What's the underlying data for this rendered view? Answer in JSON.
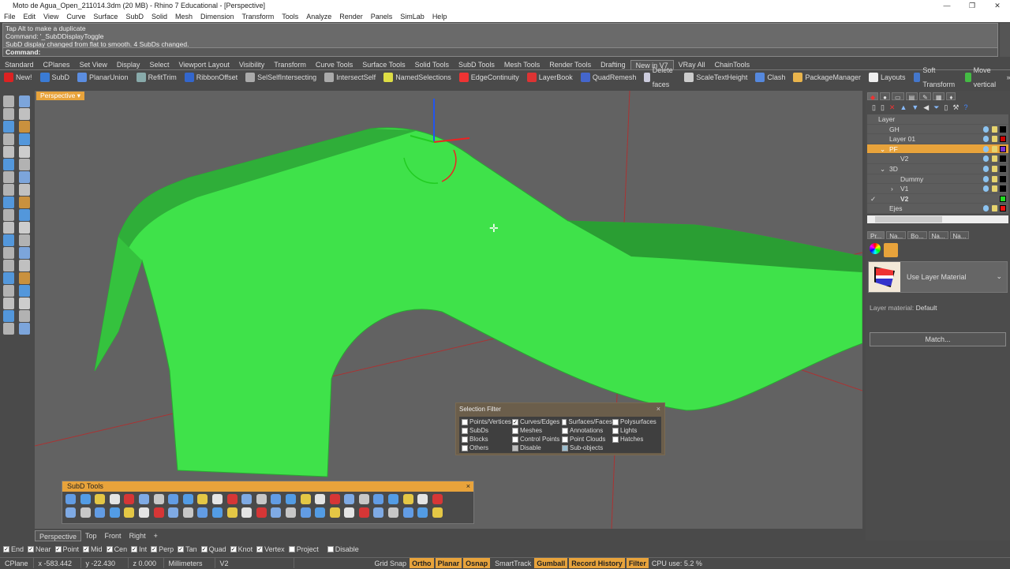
{
  "title": "Moto de Agua_Open_211014.3dm (20 MB) - Rhino 7 Educational - [Perspective]",
  "window_controls": [
    "—",
    "❐",
    "✕"
  ],
  "menu": [
    "File",
    "Edit",
    "View",
    "Curve",
    "Surface",
    "SubD",
    "Solid",
    "Mesh",
    "Dimension",
    "Transform",
    "Tools",
    "Analyze",
    "Render",
    "Panels",
    "SimLab",
    "Help"
  ],
  "command_history": [
    "Tap Alt to make a duplicate",
    "Command: '_SubDDisplayToggle",
    "SubD display changed from flat to smooth. 4 SubDs changed."
  ],
  "command_prompt": "Command:",
  "toolbar_tabs": [
    "Standard",
    "CPlanes",
    "Set View",
    "Display",
    "Select",
    "Viewport Layout",
    "Visibility",
    "Transform",
    "Curve Tools",
    "Surface Tools",
    "Solid Tools",
    "SubD Tools",
    "Mesh Tools",
    "Render Tools",
    "Drafting",
    "New in V7",
    "VRay All",
    "ChainTools"
  ],
  "active_tab": "New in V7",
  "toolbar_buttons": [
    {
      "label": "New!",
      "color": "#d22"
    },
    {
      "label": "SubD",
      "color": "#3a7bd5"
    },
    {
      "label": "PlanarUnion",
      "color": "#5b8de0"
    },
    {
      "label": "RefitTrim",
      "color": "#8aa"
    },
    {
      "label": "RibbonOffset",
      "color": "#36c"
    },
    {
      "label": "SelSelfIntersecting",
      "color": "#aaa"
    },
    {
      "label": "IntersectSelf",
      "color": "#aaa"
    },
    {
      "label": "NamedSelections",
      "color": "#dd4"
    },
    {
      "label": "EdgeContinuity",
      "color": "#e33"
    },
    {
      "label": "LayerBook",
      "color": "#d33"
    },
    {
      "label": "QuadRemesh",
      "color": "#46c"
    },
    {
      "label": "Delete faces",
      "color": "#ccd"
    },
    {
      "label": "ScaleTextHeight",
      "color": "#ccc"
    },
    {
      "label": "Clash",
      "color": "#58d"
    },
    {
      "label": "PackageManager",
      "color": "#e9b44c"
    },
    {
      "label": "Layouts",
      "color": "#eee"
    },
    {
      "label": "Soft Transform",
      "color": "#47c"
    },
    {
      "label": "Move vertical",
      "color": "#4b4"
    }
  ],
  "viewport": {
    "label": "Perspective ▾"
  },
  "layers": {
    "header": "Layer",
    "rows": [
      {
        "name": "GH",
        "indent": 1,
        "color": "#000000"
      },
      {
        "name": "Layer 01",
        "indent": 1,
        "color": "#cc0000"
      },
      {
        "name": "PF",
        "indent": 1,
        "color": "#7b2fd0",
        "selected": true,
        "expander": "⌄"
      },
      {
        "name": "V2",
        "indent": 2,
        "color": "#000000"
      },
      {
        "name": "3D",
        "indent": 1,
        "color": "#000000",
        "expander": "⌄"
      },
      {
        "name": "Dummy",
        "indent": 2,
        "color": "#000000"
      },
      {
        "name": "V1",
        "indent": 2,
        "color": "#000000",
        "expander": "›"
      },
      {
        "name": "V2",
        "indent": 2,
        "color": "#22dd22",
        "current": "✓"
      },
      {
        "name": "Ejes",
        "indent": 1,
        "color": "#ee1111"
      }
    ]
  },
  "props_tabs": [
    "Pr...",
    "Na...",
    "Bo...",
    "Na...",
    "Na..."
  ],
  "material": {
    "selection": "Use Layer Material",
    "layer_material_label": "Layer material:",
    "layer_material_value": "Default",
    "match_button": "Match..."
  },
  "selection_filter": {
    "title": "Selection Filter",
    "close": "×",
    "items": [
      {
        "label": "Points/Vertices",
        "checked": false
      },
      {
        "label": "Curves/Edges",
        "checked": true
      },
      {
        "label": "Surfaces/Faces",
        "checked": false
      },
      {
        "label": "Polysurfaces",
        "checked": false
      },
      {
        "label": "SubDs",
        "checked": false
      },
      {
        "label": "Meshes",
        "checked": false
      },
      {
        "label": "Annotations",
        "checked": false
      },
      {
        "label": "Lights",
        "checked": false
      },
      {
        "label": "Blocks",
        "checked": false
      },
      {
        "label": "Control Points",
        "checked": false
      },
      {
        "label": "Point Clouds",
        "checked": false
      },
      {
        "label": "Hatches",
        "checked": false
      },
      {
        "label": "Others",
        "checked": false
      },
      {
        "label": "Disable",
        "checked": false
      },
      {
        "label": "Sub-objects",
        "checked": false
      }
    ]
  },
  "subd_toolbar": {
    "title": "SubD Tools",
    "close": "×"
  },
  "viewport_tabs": [
    "Perspective",
    "Top",
    "Front",
    "Right",
    "+"
  ],
  "osnaps": [
    {
      "label": "End",
      "checked": true
    },
    {
      "label": "Near",
      "checked": true
    },
    {
      "label": "Point",
      "checked": true
    },
    {
      "label": "Mid",
      "checked": true
    },
    {
      "label": "Cen",
      "checked": true
    },
    {
      "label": "Int",
      "checked": true
    },
    {
      "label": "Perp",
      "checked": true
    },
    {
      "label": "Tan",
      "checked": true
    },
    {
      "label": "Quad",
      "checked": true
    },
    {
      "label": "Knot",
      "checked": true
    },
    {
      "label": "Vertex",
      "checked": true
    },
    {
      "label": "Project",
      "checked": false
    },
    {
      "label": "Disable",
      "checked": false
    }
  ],
  "status": {
    "cplane": "CPlane",
    "x": "x -583.442",
    "y": "y -22.430",
    "z": "z 0.000",
    "units": "Millimeters",
    "layer": "V2",
    "toggles": [
      {
        "label": "Grid Snap",
        "on": false
      },
      {
        "label": "Ortho",
        "on": true
      },
      {
        "label": "Planar",
        "on": true
      },
      {
        "label": "Osnap",
        "on": true
      },
      {
        "label": "SmartTrack",
        "on": false
      },
      {
        "label": "Gumball",
        "on": true
      },
      {
        "label": "Record History",
        "on": true
      },
      {
        "label": "Filter",
        "on": true
      }
    ],
    "cpu": "CPU use: 5.2 %"
  },
  "colors": {
    "accent": "#e8a33b",
    "model": "#3fe24a",
    "viewport_bg": "#626262"
  }
}
